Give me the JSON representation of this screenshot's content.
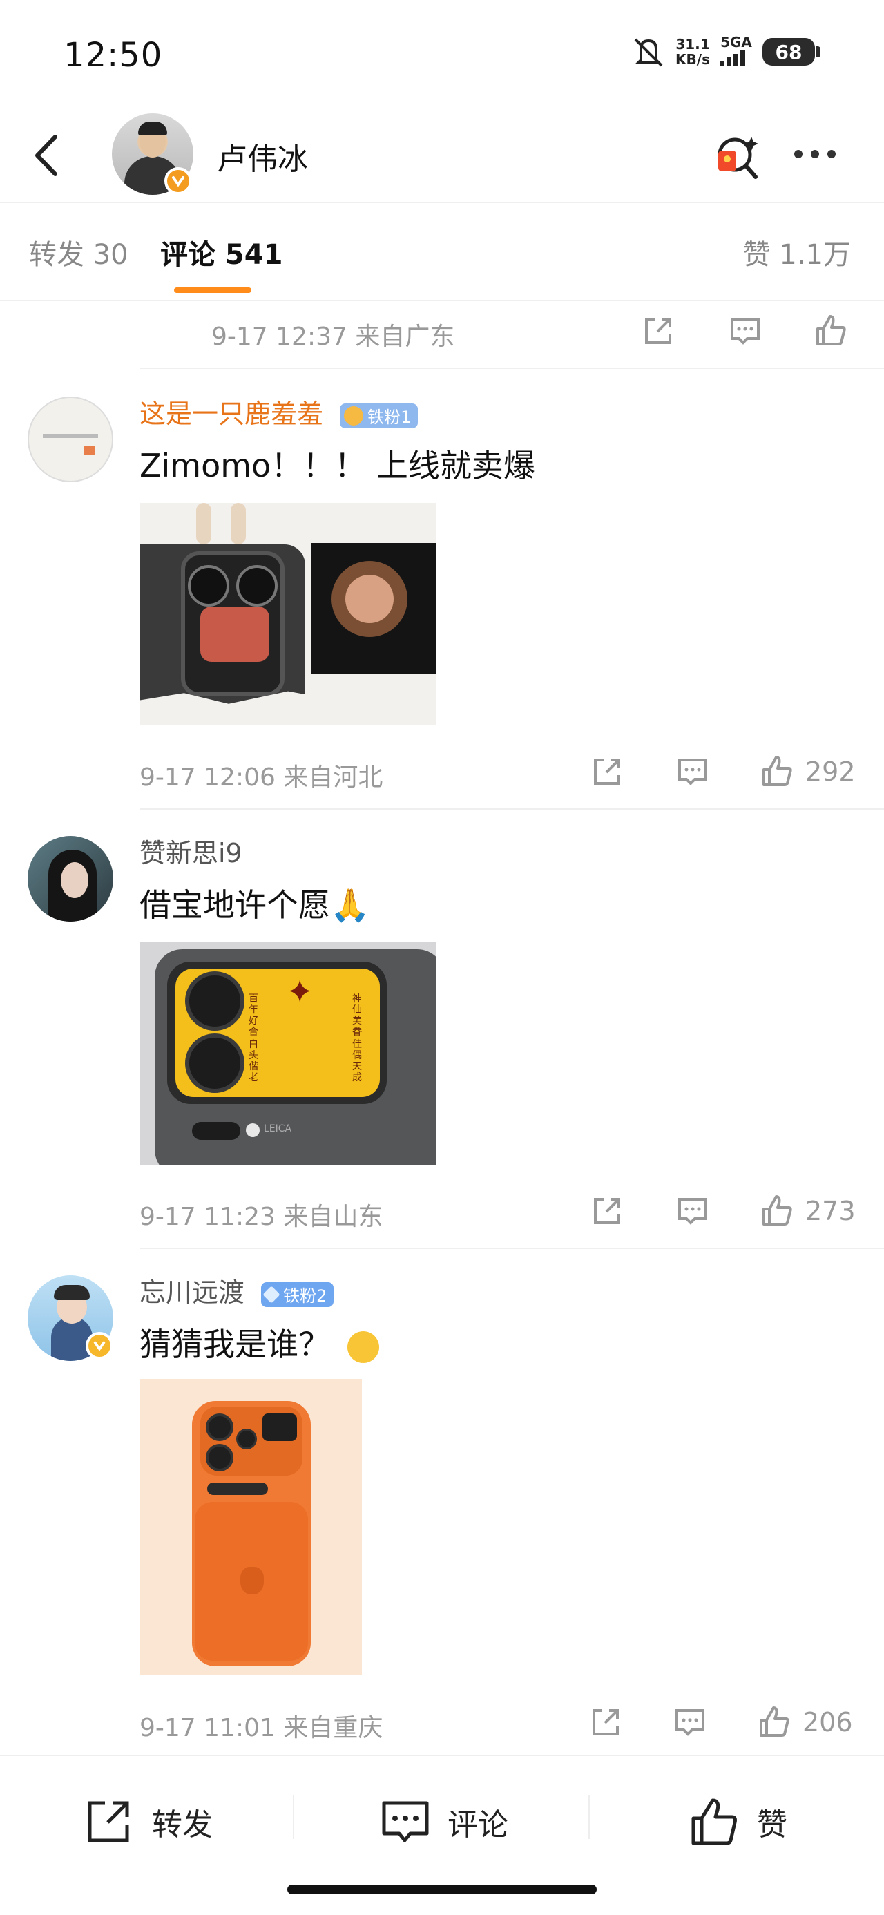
{
  "status_bar": {
    "time": "12:50",
    "net_speed": "31.1",
    "net_unit": "KB/s",
    "net_type": "5GA",
    "battery": "68"
  },
  "header": {
    "name": "卢伟冰"
  },
  "tabs": {
    "repost": "转发 30",
    "comment": "评论 541",
    "like": "赞 1.1万"
  },
  "top_meta": {
    "time_location": "9-17 12:37 来自广东"
  },
  "comments": [
    {
      "username": "这是一只鹿羞羞",
      "badge": "铁粉1",
      "text": "Zimomo！！！ 上线就卖爆",
      "time_location": "9-17 12:06 来自河北",
      "likes": "292"
    },
    {
      "username": "赞新思i9",
      "text": "借宝地许个愿🙏",
      "time_location": "9-17 11:23 来自山东",
      "likes": "273",
      "image_text": {
        "col1": "百年好合",
        "col2": "白头偕老",
        "col3": "神仙美眷",
        "col4": "佳偶天成",
        "brand": "LEICA"
      }
    },
    {
      "username": "忘川远渡",
      "badge": "铁粉2",
      "text": "猜猜我是谁？",
      "emoji": "🤭",
      "time_location": "9-17 11:01 来自重庆",
      "likes": "206"
    }
  ],
  "bottom_bar": {
    "repost": "转发",
    "comment": "评论",
    "like": "赞"
  },
  "colors": {
    "accent": "#ff8c1a",
    "username_orange": "#e8741a",
    "fan_badge_blue": "#6fa6f0"
  }
}
